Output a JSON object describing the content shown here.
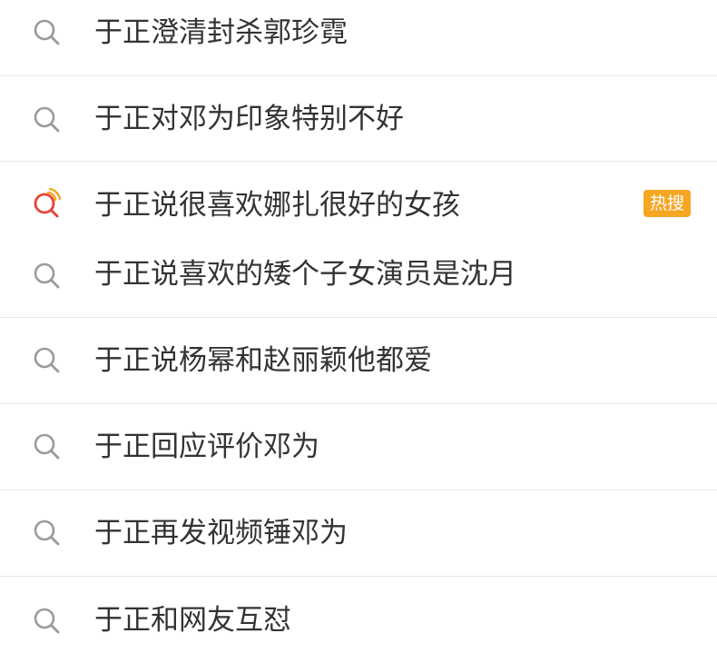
{
  "suggestions": [
    {
      "text": "于正澄清封杀郭珍霓",
      "icon": "search-icon"
    },
    {
      "text": "于正对邓为印象特别不好",
      "icon": "search-icon"
    },
    {
      "text": "于正说很喜欢娜扎很好的女孩",
      "icon": "hot-search-icon",
      "badge": "热搜"
    },
    {
      "text": "于正说喜欢的矮个子女演员是沈月",
      "icon": "search-icon"
    },
    {
      "text": "于正说杨幂和赵丽颖他都爱",
      "icon": "search-icon"
    },
    {
      "text": "于正回应评价邓为",
      "icon": "search-icon"
    },
    {
      "text": "于正再发视频锤邓为",
      "icon": "search-icon"
    },
    {
      "text": "于正和网友互怼",
      "icon": "search-icon"
    }
  ],
  "colors": {
    "text": "#333333",
    "icon_gray": "#9a9a9a",
    "hot_red": "#e8413a",
    "hot_orange": "#f5a623",
    "divider": "#e6e6e6"
  }
}
